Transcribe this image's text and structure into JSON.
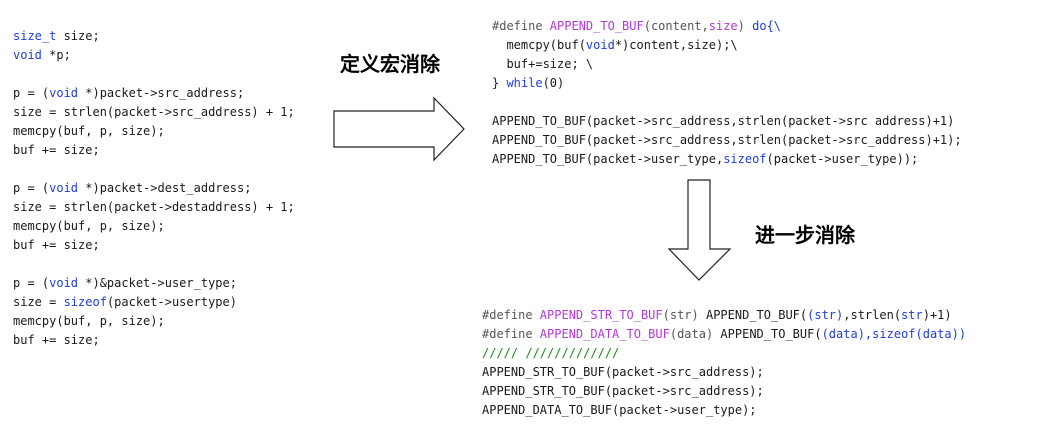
{
  "labels": {
    "step1": "定义宏消除",
    "step2": "进一步消除"
  },
  "left_code": {
    "lines": [
      [
        {
          "t": "size_t",
          "c": "kw"
        },
        {
          "t": " size;"
        }
      ],
      [
        {
          "t": "void",
          "c": "kw"
        },
        {
          "t": " *p;"
        }
      ],
      [
        {
          "t": ""
        }
      ],
      [
        {
          "t": "p = ("
        },
        {
          "t": "void",
          "c": "kw"
        },
        {
          "t": " *)packet->src_address;"
        }
      ],
      [
        {
          "t": "size = strlen(packet->src_address) + 1;"
        }
      ],
      [
        {
          "t": "memcpy(buf, p, size);"
        }
      ],
      [
        {
          "t": "buf += size;"
        }
      ],
      [
        {
          "t": ""
        }
      ],
      [
        {
          "t": "p = ("
        },
        {
          "t": "void",
          "c": "kw"
        },
        {
          "t": " *)packet->dest_address;"
        }
      ],
      [
        {
          "t": "size = strlen(packet->destaddress) + 1;"
        }
      ],
      [
        {
          "t": "memcpy(buf, p, size);"
        }
      ],
      [
        {
          "t": "buf += size;"
        }
      ],
      [
        {
          "t": ""
        }
      ],
      [
        {
          "t": "p = ("
        },
        {
          "t": "void",
          "c": "kw"
        },
        {
          "t": " *)&packet->user_type;"
        }
      ],
      [
        {
          "t": "size = "
        },
        {
          "t": "sizeof",
          "c": "kw"
        },
        {
          "t": "(packet->usertype)"
        }
      ],
      [
        {
          "t": "memcpy(buf, p, size);"
        }
      ],
      [
        {
          "t": "buf += size;"
        }
      ]
    ]
  },
  "macro_code": {
    "lines": [
      [
        {
          "t": "#define ",
          "c": "pp"
        },
        {
          "t": "APPEND_TO_BUF",
          "c": "mac"
        },
        {
          "t": "(content,",
          "c": "pp"
        },
        {
          "t": "size",
          "c": "mac"
        },
        {
          "t": ") ",
          "c": "pp"
        },
        {
          "t": "do",
          "c": "kw"
        },
        {
          "t": "{\\",
          "c": "kw"
        }
      ],
      [
        {
          "t": "  memcpy(buf("
        },
        {
          "t": "void",
          "c": "kw"
        },
        {
          "t": "*)content,size);\\"
        }
      ],
      [
        {
          "t": "  buf+=size; \\"
        }
      ],
      [
        {
          "t": "} "
        },
        {
          "t": "while",
          "c": "kw"
        },
        {
          "t": "(0)"
        }
      ],
      [
        {
          "t": ""
        }
      ],
      [
        {
          "t": "APPEND_TO_BUF(packet->src_address,strlen(packet->src address)+1)"
        }
      ],
      [
        {
          "t": "APPEND_TO_BUF(packet->src_address,strlen(packet->src_address)+1);"
        }
      ],
      [
        {
          "t": "APPEND_TO_BUF(packet->user_type,"
        },
        {
          "t": "sizeof",
          "c": "kw"
        },
        {
          "t": "(packet->user_type));"
        }
      ]
    ]
  },
  "final_code": {
    "lines": [
      [
        {
          "t": "#define ",
          "c": "pp"
        },
        {
          "t": "APPEND_STR_TO_BUF",
          "c": "mac"
        },
        {
          "t": "(str)",
          "c": "pp"
        },
        {
          "t": " APPEND_TO_BUF("
        },
        {
          "t": "(str)",
          "c": "kw"
        },
        {
          "t": ",strlen("
        },
        {
          "t": "str",
          "c": "kw"
        },
        {
          "t": ")+1)"
        }
      ],
      [
        {
          "t": "#define ",
          "c": "pp"
        },
        {
          "t": "APPEND_DATA_TO_BUF",
          "c": "mac"
        },
        {
          "t": "(data)",
          "c": "pp"
        },
        {
          "t": " APPEND_TO_BUF("
        },
        {
          "t": "(data),sizeof(data))",
          "c": "kw"
        }
      ],
      [
        {
          "t": "///// /////////////",
          "c": "cmt"
        }
      ],
      [
        {
          "t": "APPEND_STR_TO_BUF(packet->src_address);"
        }
      ],
      [
        {
          "t": "APPEND_STR_TO_BUF(packet->src_address);"
        }
      ],
      [
        {
          "t": "APPEND_DATA_TO_BUF(packet->user_type);"
        }
      ]
    ]
  }
}
